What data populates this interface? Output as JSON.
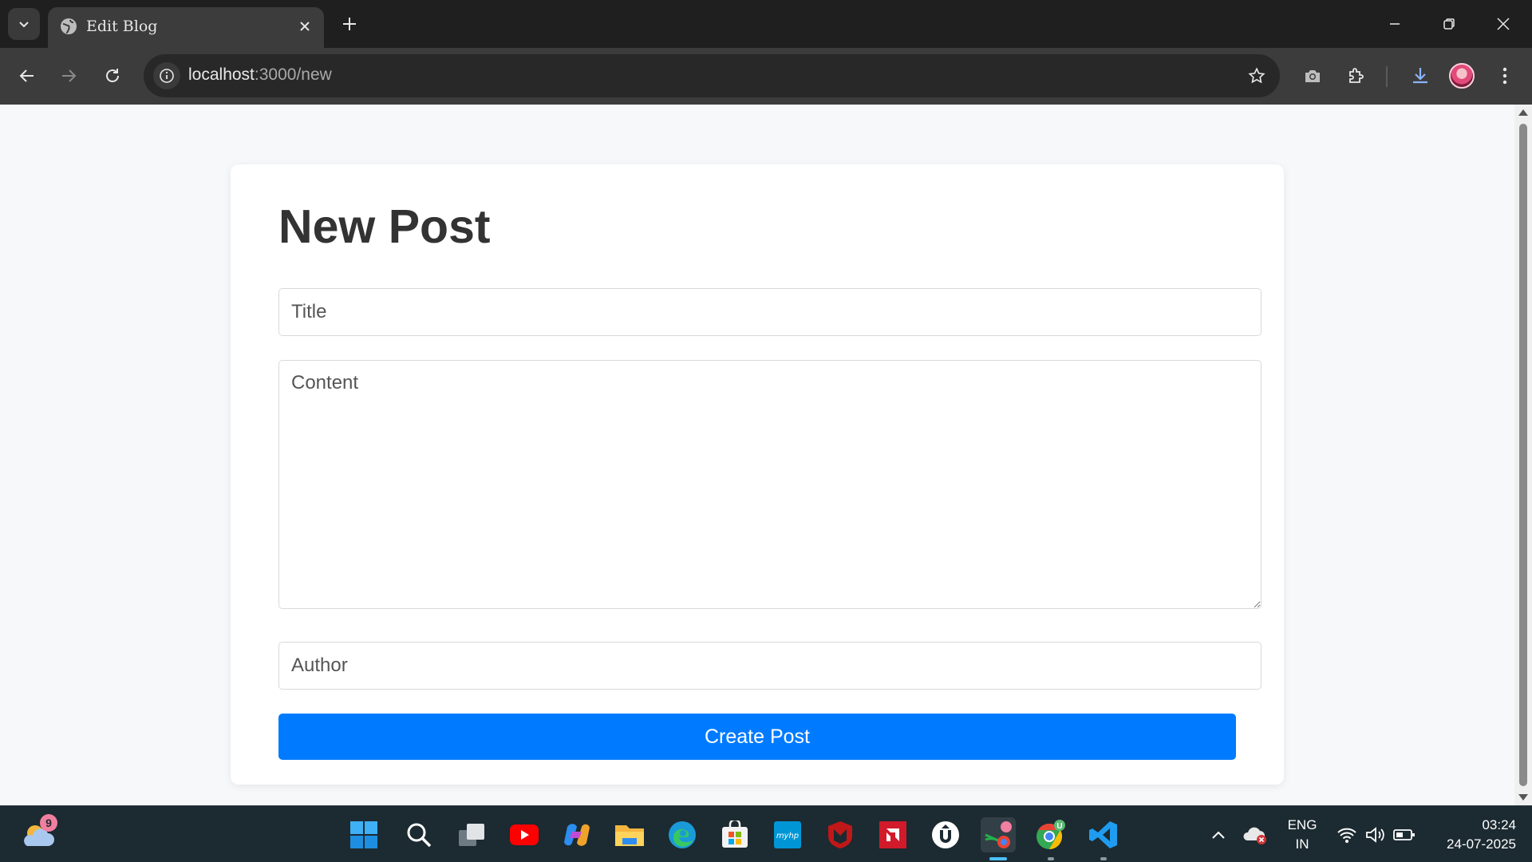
{
  "browser": {
    "tab_title": "Edit Blog",
    "url_host": "localhost",
    "url_rest": ":3000/new"
  },
  "page": {
    "heading": "New Post",
    "title_placeholder": "Title",
    "content_placeholder": "Content",
    "author_placeholder": "Author",
    "submit_label": "Create Post",
    "accent_color": "#007bff"
  },
  "taskbar": {
    "weather_badge": "9",
    "language": "ENG",
    "region": "IN",
    "time": "03:24",
    "date": "24-07-2025",
    "pinned": [
      "windows-start-icon",
      "search-icon",
      "task-view-icon",
      "youtube-icon",
      "copilot-icon",
      "file-explorer-icon",
      "edge-icon",
      "microsoft-store-icon",
      "myhp-icon",
      "mcafee-icon",
      "amd-icon",
      "uptodown-icon",
      "snipping-tool-icon",
      "chrome-icon",
      "vscode-icon"
    ],
    "chrome_badge": "U"
  }
}
